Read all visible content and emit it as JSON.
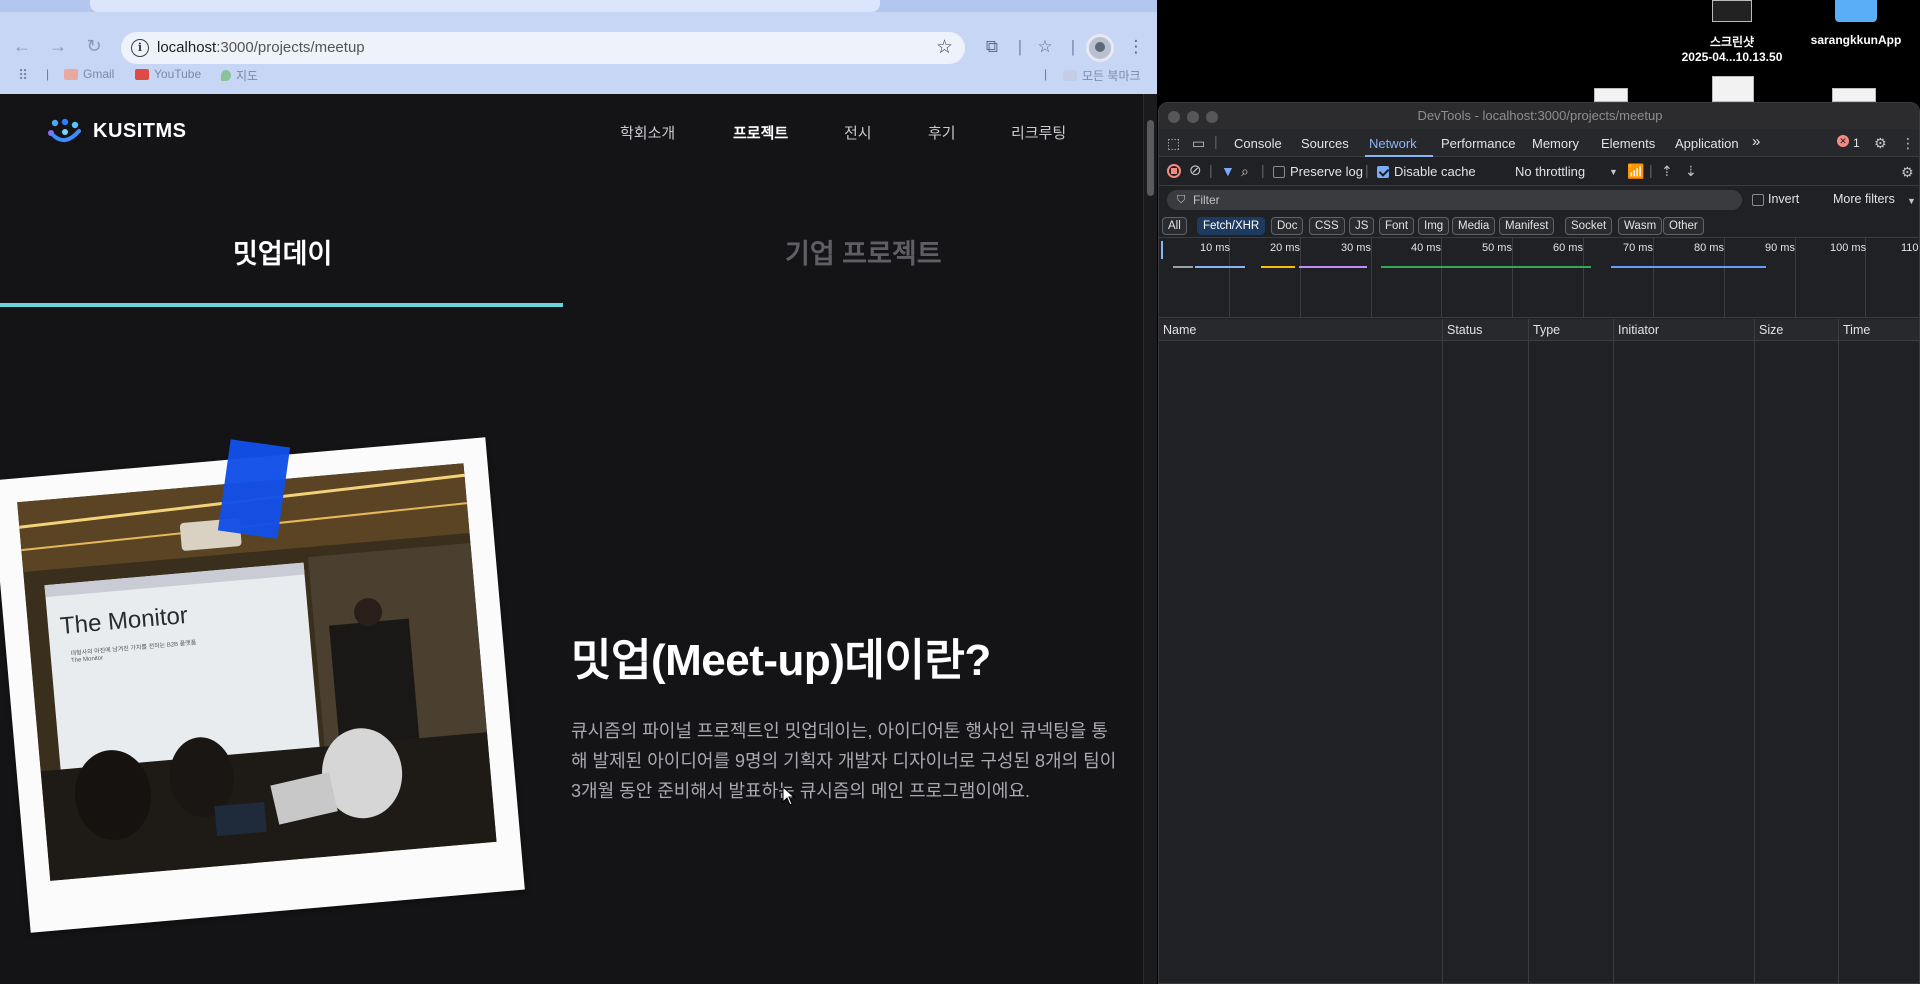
{
  "browser": {
    "url_host": "localhost",
    "url_path": ":3000/projects/meetup",
    "bookmarks": [
      {
        "label": "Gmail"
      },
      {
        "label": "YouTube"
      },
      {
        "label": "지도"
      }
    ],
    "all_bookmarks_label": "모든 북마크"
  },
  "site": {
    "logo_text": "KUSITMS",
    "nav": [
      "학회소개",
      "프로젝트",
      "전시",
      "후기",
      "리크루팅"
    ],
    "active_nav": "프로젝트",
    "tabs": [
      "밋업데이",
      "기업 프로젝트"
    ],
    "active_tab": "밋업데이",
    "photo_slide_text": "The Monitor",
    "photo_slide_subtext": "대형사의 마진에 남겨진 가치를 전하는 B2B 플랫폼",
    "photo_slide_subtext2": "The Monitor",
    "heading": "밋업(Meet-up)데이란?",
    "description_lines": [
      "큐시즘의 파이널 프로젝트인 밋업데이는, 아이디어톤 행사인 큐넥팅을 통",
      "해 발제된 아이디어를 9명의 기획자 개발자 디자이너로 구성된 8개의 팀이",
      "3개월 동안 준비해서 발표하는 큐시즘의 메인 프로그램이에요."
    ],
    "accent_color": "#6ad4dd",
    "tape_color": "#1350e8"
  },
  "desktop": {
    "items": [
      {
        "label_line1": "스크린샷",
        "label_line2": "2025-04...10.13.50"
      },
      {
        "label_line1": "sarangkkunApp",
        "label_line2": ""
      }
    ]
  },
  "devtools": {
    "title": "DevTools - localhost:3000/projects/meetup",
    "tabs": [
      "Console",
      "Sources",
      "Network",
      "Performance",
      "Memory",
      "Elements",
      "Application"
    ],
    "active_tab": "Network",
    "error_count": "1",
    "preserve_log_label": "Preserve log",
    "preserve_log": false,
    "disable_cache_label": "Disable cache",
    "disable_cache": true,
    "throttling": "No throttling",
    "filter_placeholder": "Filter",
    "invert_label": "Invert",
    "more_filters_label": "More filters",
    "type_filters": [
      "All",
      "Fetch/XHR",
      "Doc",
      "CSS",
      "JS",
      "Font",
      "Img",
      "Media",
      "Manifest",
      "Socket",
      "Wasm",
      "Other"
    ],
    "active_type_filter": "Fetch/XHR",
    "timeline_ticks": [
      "10 ms",
      "20 ms",
      "30 ms",
      "40 ms",
      "50 ms",
      "60 ms",
      "70 ms",
      "80 ms",
      "90 ms",
      "100 ms",
      "110"
    ],
    "columns": [
      "Name",
      "Status",
      "Type",
      "Initiator",
      "Size",
      "Time"
    ]
  }
}
